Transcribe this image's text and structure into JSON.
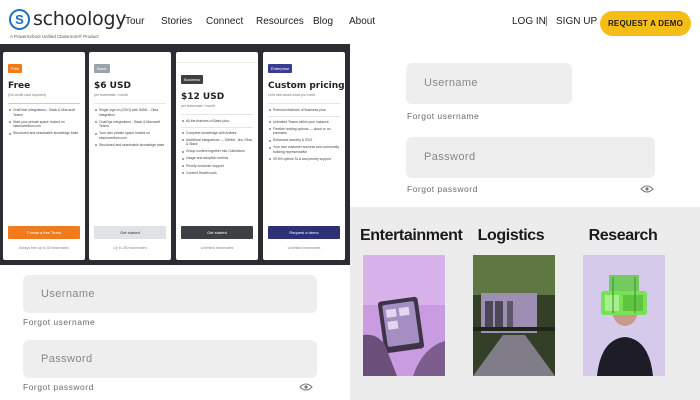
{
  "header": {
    "logo_text": "schoology",
    "logo_mark": "S",
    "logo_tagline": "A PowerSchool Unified Classroom® Product",
    "nav": [
      "Tour",
      "Stories",
      "Connect",
      "Resources",
      "Blog",
      "About"
    ],
    "login": "LOG IN",
    "separator": "|",
    "signup": "SIGN UP",
    "demo": "REQUEST A DEMO",
    "demo_color": "#f7bd17"
  },
  "pricing": {
    "cards": [
      {
        "badge": "Free",
        "badge_color": "#f07b1c",
        "title": "Free",
        "subtitle": "(No credit card required)",
        "features": [
          "OneDrive integrations - Slack & Microsoft Teams",
          "Start your private space hosted on stackoverflow.com",
          "Structured and searchable knowledge base"
        ],
        "button": "Create a free Team",
        "button_color": "#f07b1c",
        "note": "Always free up to 50 teammates"
      },
      {
        "badge": "Basic",
        "badge_color": "#9aa3ab",
        "title": "$6 USD",
        "subtitle": "per teammate / month",
        "features": [
          "Single sign-on (SSO) with SAML - Okta integration",
          "ChatOps integrations - Slack & Microsoft Teams",
          "Your own private space hosted on stackoverflow.com",
          "Structured and searchable knowledge base"
        ],
        "button": "Get started",
        "button_color": "#dfe3e6",
        "note": "Up to 250 teammates"
      },
      {
        "badge": "Business",
        "badge_color": "#3c3f44",
        "title": "$12 USD",
        "subtitle": "per teammate / month",
        "features": [
          "All the features of Basic plus:",
          "Complete knowledge with Articles",
          "Additional integrations — GitHub, Jira, Okta, & Slack",
          "Group content together into Collections",
          "Usage and adoption metrics",
          "Priority customer support",
          "Content Health tools"
        ],
        "button": "Get started",
        "button_color": "#3c3f44",
        "note": "Unlimited teammates"
      },
      {
        "badge": "Enterprise",
        "badge_color": "#3a3d8f",
        "title": "Custom pricing",
        "subtitle": "Let's talk about what you need",
        "features": [
          "Premium features of Business plus:",
          "Unlimited Teams within your instance",
          "Flexible hosting options — cloud or on-premises",
          "Enhanced security & SSO",
          "Your own customer success and community building representative",
          "99.5% uptime SLA and priority support"
        ],
        "button": "Request a demo",
        "button_color": "#2d3277",
        "note": "Unlimited teammates"
      }
    ]
  },
  "login_top": {
    "username_placeholder": "Username",
    "forgot_username": "Forgot username",
    "password_placeholder": "Password",
    "forgot_password": "Forgot password"
  },
  "login_bottom": {
    "username_placeholder": "Username",
    "forgot_username": "Forgot username",
    "password_placeholder": "Password",
    "forgot_password": "Forgot password"
  },
  "industries": {
    "items": [
      "Entertainment",
      "Logistics",
      "Research"
    ]
  }
}
